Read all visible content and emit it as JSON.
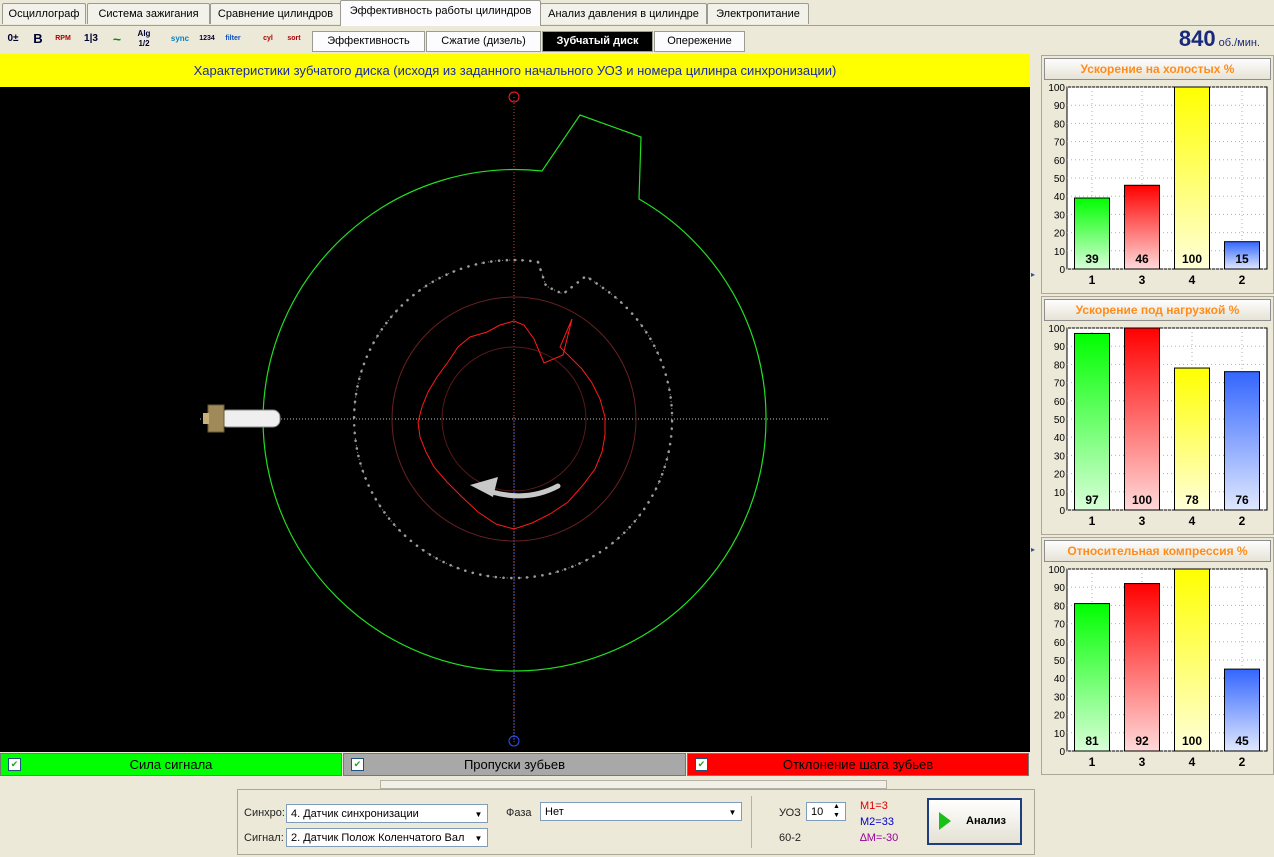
{
  "top_tabs": [
    {
      "label": "Осциллограф"
    },
    {
      "label": "Система зажигания"
    },
    {
      "label": "Сравнение цилиндров"
    },
    {
      "label": "Эффективность работы цилиндров",
      "active": true
    },
    {
      "label": "Анализ давления в цилиндре"
    },
    {
      "label": "Электропитание"
    }
  ],
  "toolbar_icons": [
    "0±",
    "B",
    "RPM",
    "1|3",
    "~",
    "Alg 1/2",
    "sync",
    "1234",
    "filter",
    "cyl",
    "sort"
  ],
  "sub_tabs": [
    {
      "label": "Эффективность"
    },
    {
      "label": "Сжатие (дизель)"
    },
    {
      "label": "Зубчатый диск",
      "active": true
    },
    {
      "label": "Опережение"
    }
  ],
  "rpm": {
    "value": "840",
    "unit": "об./мин."
  },
  "banner_text": "Характеристики зубчатого диска (исходя из заданного начального УОЗ и номера цилинра синхронизации)",
  "legend": [
    {
      "label": "Сила сигнала",
      "color": "#00ff00"
    },
    {
      "label": "Пропуски зубьев",
      "color": "#a8a8a8"
    },
    {
      "label": "Отклонение шага зубьев",
      "color": "#ff0000"
    }
  ],
  "charts": [
    {
      "title": "Ускорение на холостых %",
      "chart_data": {
        "type": "bar",
        "categories": [
          "1",
          "3",
          "4",
          "2"
        ],
        "values": [
          39,
          46,
          100,
          15
        ],
        "ylim": [
          0,
          100
        ],
        "yticks": [
          0,
          10,
          20,
          30,
          40,
          50,
          60,
          70,
          80,
          90,
          100
        ],
        "colors": [
          "#00ff00",
          "#ff0000",
          "#ffff00",
          "#3366ff"
        ]
      }
    },
    {
      "title": "Ускорение под нагрузкой %",
      "chart_data": {
        "type": "bar",
        "categories": [
          "1",
          "3",
          "4",
          "2"
        ],
        "values": [
          97,
          100,
          78,
          76
        ],
        "ylim": [
          0,
          100
        ],
        "yticks": [
          0,
          10,
          20,
          30,
          40,
          50,
          60,
          70,
          80,
          90,
          100
        ],
        "colors": [
          "#00ff00",
          "#ff0000",
          "#ffff00",
          "#3366ff"
        ]
      }
    },
    {
      "title": "Относительная компрессия %",
      "chart_data": {
        "type": "bar",
        "categories": [
          "1",
          "3",
          "4",
          "2"
        ],
        "values": [
          81,
          92,
          100,
          45
        ],
        "ylim": [
          0,
          100
        ],
        "yticks": [
          0,
          10,
          20,
          30,
          40,
          50,
          60,
          70,
          80,
          90,
          100
        ],
        "colors": [
          "#00ff00",
          "#ff0000",
          "#ffff00",
          "#3366ff"
        ]
      }
    }
  ],
  "bottom": {
    "synchro_label": "Синхро:",
    "synchro_value": "4.  Датчик синхронизации",
    "signal_label": "Сигнал:",
    "signal_value": "2.  Датчик Полож Коленчатого Вал",
    "phase_label": "Фаза",
    "phase_value": "Нет",
    "uoz_label": "УОЗ",
    "uoz_value": "10",
    "disk_type": "60-2",
    "m1": "M1=3",
    "m2": "M2=33",
    "dm": "∆M=-30",
    "analyze_label": "Анализ"
  }
}
